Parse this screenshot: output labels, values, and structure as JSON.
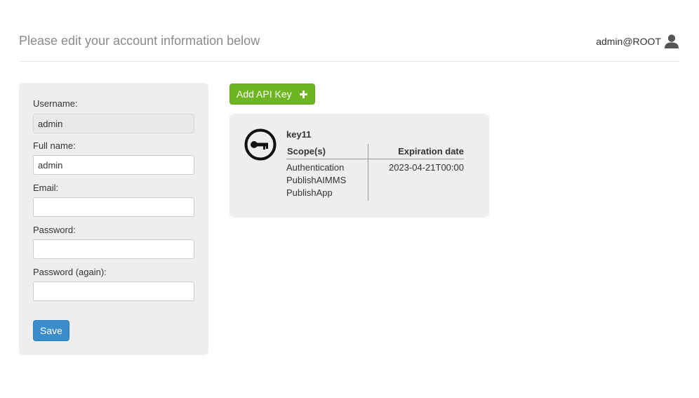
{
  "header": {
    "title": "Please edit your account information below",
    "user": "admin@ROOT",
    "user_icon": "user-icon"
  },
  "form": {
    "username_label": "Username:",
    "username_value": "admin",
    "fullname_label": "Full name:",
    "fullname_value": "admin",
    "email_label": "Email:",
    "email_value": "",
    "password_label": "Password:",
    "password_value": "",
    "password_again_label": "Password (again):",
    "password_again_value": "",
    "save_label": "Save"
  },
  "api_keys": {
    "add_label": "Add API Key",
    "add_icon": "plus-icon",
    "scope_header": "Scope(s)",
    "expiration_header": "Expiration date",
    "keys": [
      {
        "name": "key11",
        "icon": "key-icon",
        "scopes": [
          "Authentication",
          "PublishAIMMS",
          "PublishApp"
        ],
        "expiration": "2023-04-21T00:00"
      }
    ]
  },
  "colors": {
    "save_button": "#3a8ccb",
    "add_button": "#6db521",
    "panel_background": "#eeeeee"
  }
}
